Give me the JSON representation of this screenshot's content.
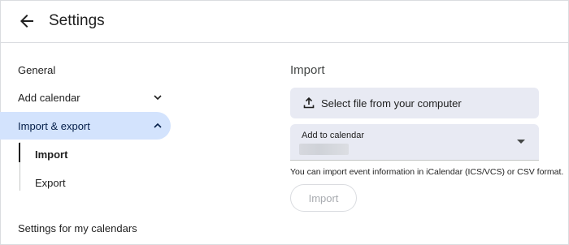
{
  "header": {
    "title": "Settings",
    "back_icon": "arrow-back-icon"
  },
  "sidebar": {
    "items": [
      {
        "label": "General"
      },
      {
        "label": "Add calendar",
        "icon": "chevron-down-icon"
      },
      {
        "label": "Import & export",
        "icon": "chevron-up-icon",
        "active": true
      }
    ],
    "subitems": [
      {
        "label": "Import",
        "active": true
      },
      {
        "label": "Export"
      }
    ],
    "section_heading": "Settings for my calendars"
  },
  "main": {
    "title": "Import",
    "select_file_label": "Select file from your computer",
    "select_file_icon": "upload-icon",
    "dropdown": {
      "label": "Add to calendar",
      "icon": "caret-down-icon"
    },
    "helper_text": "You can import event information in iCalendar (ICS/VCS) or CSV format.",
    "import_button": "Import"
  },
  "colors": {
    "active_bg": "#d3e3fd",
    "field_bg": "#e8eaf3",
    "border": "#dadce0"
  }
}
